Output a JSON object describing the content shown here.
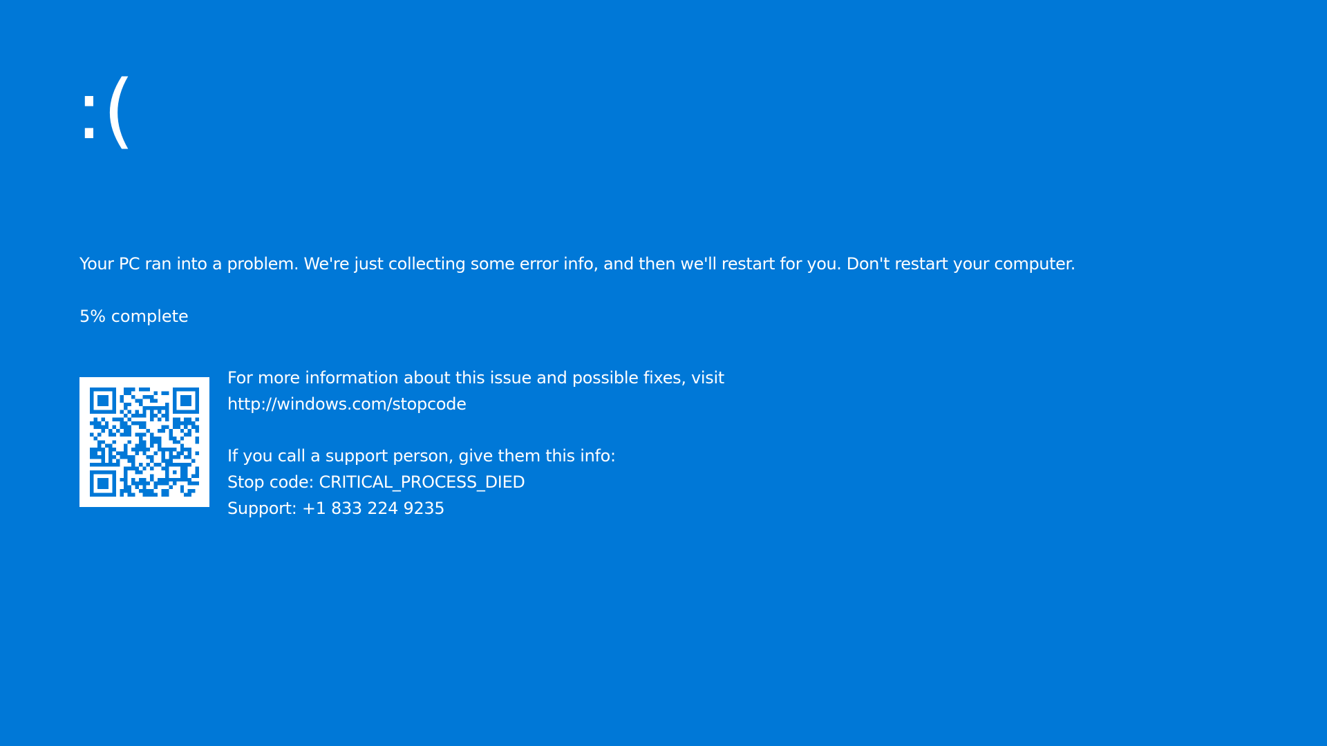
{
  "emoticon": ":(",
  "message": "Your PC ran into a problem. We're just collecting some error info, and then we'll restart for you. Don't restart your computer.",
  "progress": {
    "percent": 5,
    "label": "5% complete"
  },
  "qr_code": {
    "icon": "qr-code-icon",
    "color": "#0078D7"
  },
  "info": {
    "more_info_line": "For more information about this issue and possible fixes, visit",
    "url": "http://windows.com/stopcode",
    "support_prompt": "If you call a support person, give them this info:",
    "stop_code": "Stop code: CRITICAL_PROCESS_DIED",
    "support_phone": "Support: +1 833 224 9235"
  },
  "colors": {
    "background": "#0078D7",
    "text": "#FFFFFF"
  }
}
